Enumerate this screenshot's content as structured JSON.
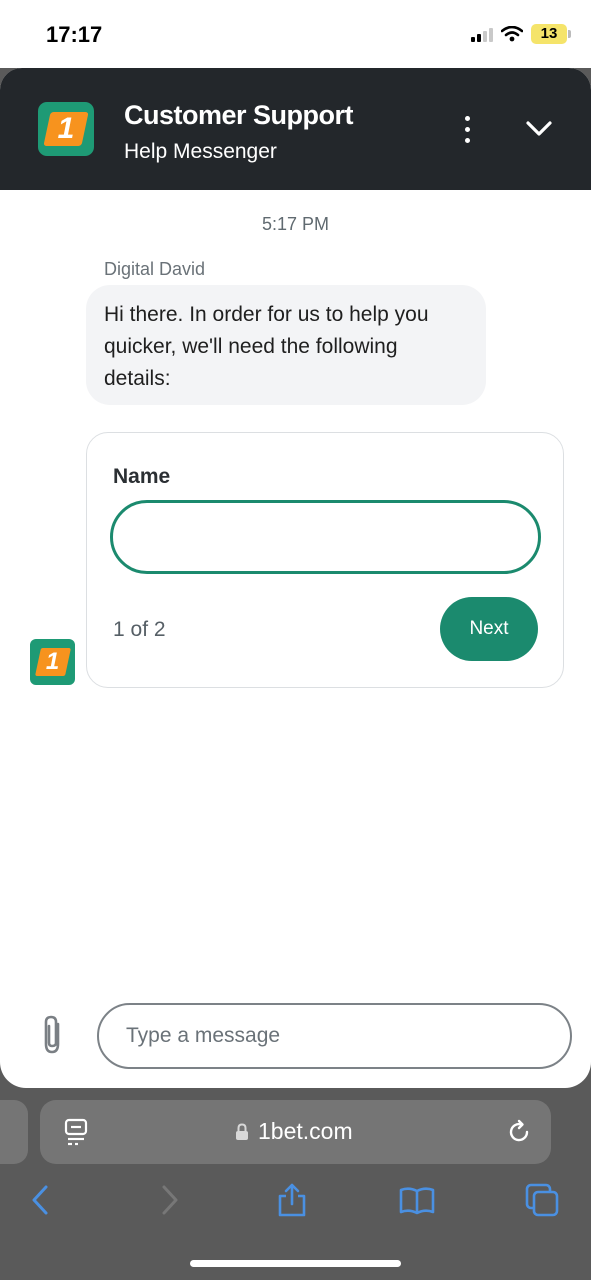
{
  "status_bar": {
    "time": "17:17",
    "battery": "13"
  },
  "chat_header": {
    "title": "Customer Support",
    "subtitle": "Help Messenger",
    "logo_text": "1"
  },
  "conversation": {
    "timestamp": "5:17 PM",
    "sender": "Digital David",
    "message": "Hi there. In order for us to help you quicker, we'll need the following details:"
  },
  "form": {
    "label": "Name",
    "name_value": "",
    "step": "1 of 2",
    "next_label": "Next"
  },
  "composer": {
    "placeholder": "Type a message"
  },
  "browser": {
    "url": "1bet.com"
  },
  "colors": {
    "header_bg": "#23272b",
    "brand_green": "#1b8a6e",
    "brand_orange": "#f7931e",
    "bubble_bg": "#f3f4f6",
    "browser_bg": "#5a5a5a",
    "ios_blue": "#4a90e2"
  },
  "icons": {
    "header": [
      "more-vertical-icon",
      "chevron-down-icon"
    ],
    "composer": [
      "paperclip-icon"
    ],
    "browser": [
      "reader-icon",
      "lock-icon",
      "reload-icon",
      "back-icon",
      "forward-icon",
      "share-icon",
      "bookmarks-icon",
      "tabs-icon"
    ]
  }
}
